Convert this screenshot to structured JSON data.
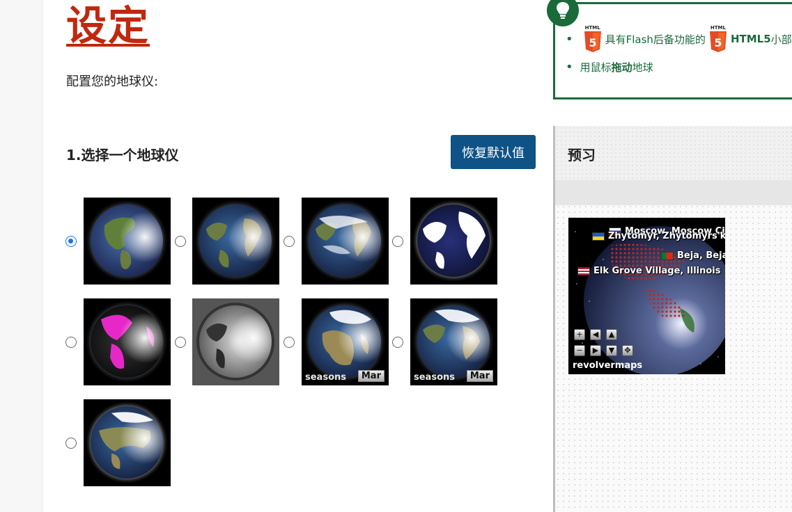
{
  "page": {
    "title": "设定",
    "intro": "配置您的地球仪:"
  },
  "section": {
    "title": "1.选择一个地球仪",
    "reset_label": "恢复默认值"
  },
  "globes": [
    {
      "id": "g1",
      "selected": true,
      "style": "classic-blue"
    },
    {
      "id": "g2",
      "selected": false,
      "style": "realistic-atlantic"
    },
    {
      "id": "g3",
      "selected": false,
      "style": "cloudy"
    },
    {
      "id": "g4",
      "selected": false,
      "style": "white-navy"
    },
    {
      "id": "g5",
      "selected": false,
      "style": "magenta"
    },
    {
      "id": "g6",
      "selected": false,
      "style": "grayscale"
    },
    {
      "id": "g7",
      "selected": false,
      "style": "seasons-europe",
      "seasons_label": "seasons",
      "month_label": "Mar"
    },
    {
      "id": "g8",
      "selected": false,
      "style": "seasons-atlantic",
      "seasons_label": "seasons",
      "month_label": "Mar"
    },
    {
      "id": "g9",
      "selected": false,
      "style": "eurasia"
    }
  ],
  "tip": {
    "item1_prefix": "具有Flash后备功能的",
    "html5_logo_text": "HTML",
    "item1_bold": "HTML5",
    "item1_suffix": "小部件",
    "item2_prefix": "用鼠标",
    "item2_bold": "拖动",
    "item2_suffix": "地球"
  },
  "preview": {
    "title": "预习",
    "labels": {
      "moscow": "Moscow, Moscow City",
      "zhytomyr": "Zhytomyr, Zhytomyrs'ka",
      "beja": "Beja, Beja",
      "elk": "Elk Grove Village, Illinois"
    },
    "brand": "revolvermaps"
  },
  "colors": {
    "title_red": "#c0280e",
    "button_blue": "#0f5285",
    "tip_green": "#1a6b3a",
    "radio_blue": "#1a73e8"
  }
}
